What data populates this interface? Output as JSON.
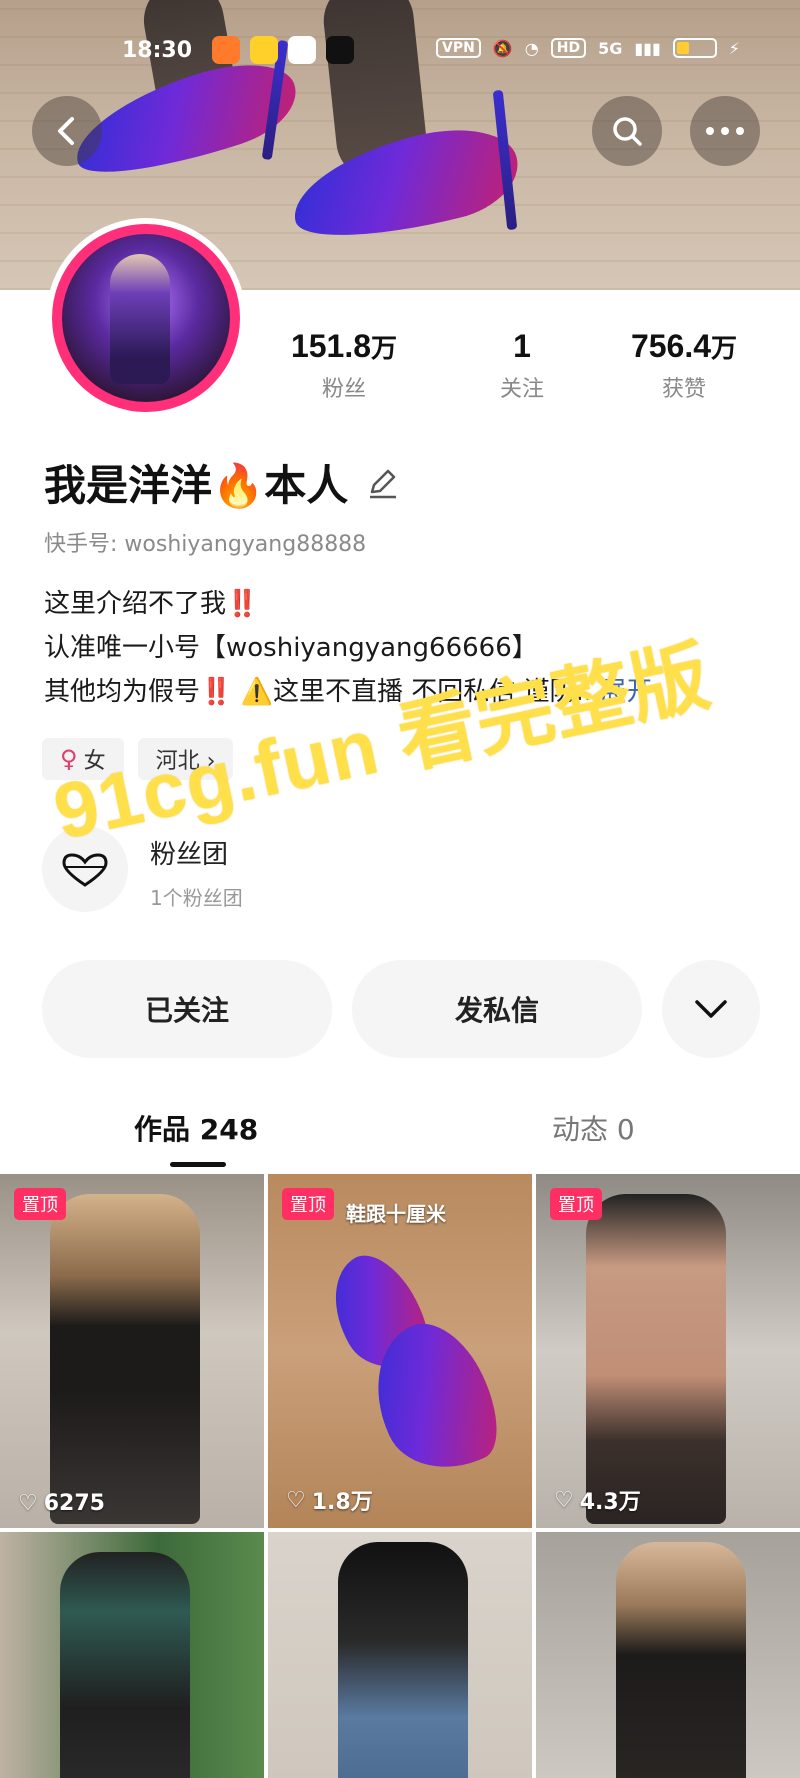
{
  "status_bar": {
    "time": "18:30",
    "vpn": "VPN",
    "hd": "HD",
    "network": "5G"
  },
  "profile": {
    "stats": [
      {
        "value": "151.8",
        "unit": "万",
        "label": "粉丝"
      },
      {
        "value": "1",
        "unit": "",
        "label": "关注"
      },
      {
        "value": "756.4",
        "unit": "万",
        "label": "获赞"
      }
    ],
    "name": "我是洋洋🔥本人",
    "kuaishou_id": "快手号: woshiyangyang88888",
    "bio_line1": "这里介绍不了我",
    "bio_line1_mark": "‼️",
    "bio_line2": "认准唯一小号【woshiyangyang66666】",
    "bio_line3_a": "其他均为假号",
    "bio_line3_mark": "‼️",
    "bio_line3_warn": "⚠️",
    "bio_line3_b": "这里不直播 不回私信 谨防...",
    "expand": "展开",
    "tags": [
      {
        "icon": "♀",
        "label": "女"
      },
      {
        "label": "河北 ›"
      }
    ],
    "fanclub_title": "粉丝团",
    "fanclub_sub": "1个粉丝团"
  },
  "watermark": "91cg.fun 看完整版",
  "actions": {
    "follow": "已关注",
    "message": "发私信"
  },
  "tabs": [
    {
      "label": "作品 248"
    },
    {
      "label": "动态 0"
    }
  ],
  "works": [
    {
      "pinned": "置顶",
      "caption": "",
      "likes": "6275"
    },
    {
      "pinned": "置顶",
      "caption": "鞋跟十厘米",
      "likes": "1.8万"
    },
    {
      "pinned": "置顶",
      "caption": "",
      "likes": "4.3万"
    },
    {
      "pinned": "",
      "caption": "",
      "likes": ""
    },
    {
      "pinned": "",
      "caption": "",
      "likes": ""
    },
    {
      "pinned": "",
      "caption": "",
      "likes": ""
    }
  ],
  "colors": {
    "accent_pink": "#ff2f63",
    "avatar_ring": "#ff2f7a",
    "link_blue": "#3a65b0",
    "watermark_yellow": "#ffe04a"
  }
}
